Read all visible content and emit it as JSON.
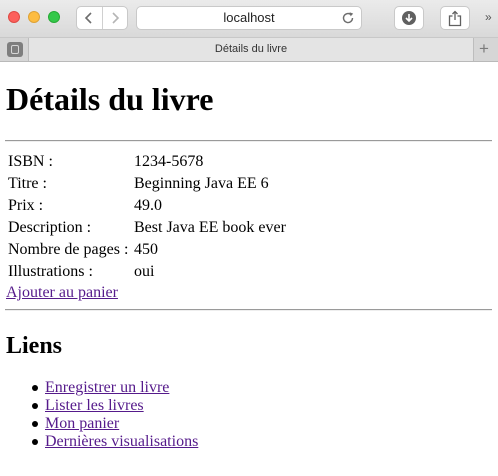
{
  "browser": {
    "url": "localhost",
    "tab_title": "Détails du livre",
    "icons": {
      "back": "chevron-left-icon",
      "forward": "chevron-right-icon",
      "reload": "reload-icon",
      "download": "download-icon",
      "share": "share-icon",
      "more": "overflow-icon",
      "new_tab": "plus-icon"
    },
    "new_tab_glyph": "+",
    "more_glyph": "»",
    "colors": {
      "close": "#fc605c",
      "minimize": "#fdbc40",
      "zoom": "#34c84a"
    }
  },
  "page": {
    "title": "Détails du livre",
    "book": [
      {
        "label": "ISBN :",
        "value": "1234-5678"
      },
      {
        "label": "Titre :",
        "value": "Beginning Java EE 6"
      },
      {
        "label": "Prix :",
        "value": "49.0"
      },
      {
        "label": "Description :",
        "value": "Best Java EE book ever"
      },
      {
        "label": "Nombre de pages :",
        "value": "450"
      },
      {
        "label": "Illustrations :",
        "value": "oui"
      }
    ],
    "add_to_cart": "Ajouter au panier",
    "links_heading": "Liens",
    "links": [
      "Enregistrer un livre",
      "Lister les livres",
      "Mon panier",
      "Dernières visualisations"
    ],
    "link_color": "#551a8b"
  }
}
